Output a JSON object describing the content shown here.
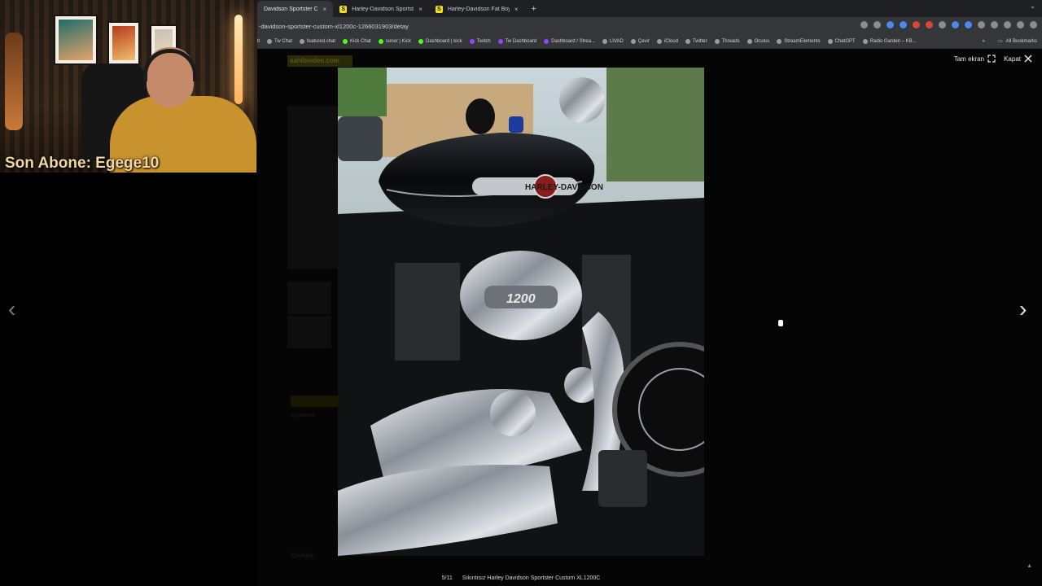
{
  "browser": {
    "tabs": [
      {
        "title": "Davidson Sportster C",
        "active": true,
        "has_favicon": false
      },
      {
        "title": "Harley-Davidson Sportster X",
        "active": false,
        "has_favicon": true
      },
      {
        "title": "Harley-Davidson Fat Boy FLS",
        "active": false,
        "has_favicon": true
      }
    ],
    "favicon_letter": "S",
    "tab_close": "×",
    "new_tab": "+",
    "url": "-davidson-sportster-custom-xl1200c-1266031903/detay",
    "bookmarks": [
      "lt",
      "Tw Chat",
      "featured.chat",
      "Kick Chat",
      "soner | Kick",
      "Dashboard | kick",
      "Twitch",
      "Tw Dashboard",
      "Dashboard / Strea...",
      "LIVAD",
      "Çevir",
      "iCloud",
      "Twitter",
      "Threads",
      "Oculus",
      "StreamElements",
      "ChatGPT",
      "Radio Garden – KB..."
    ],
    "bookmarks_overflow": "»",
    "all_bookmarks": "All Bookmarks"
  },
  "webcam": {
    "overlay_text": "Son Abone: Egege10"
  },
  "background_page": {
    "logo": "sahibinden.com",
    "description_label": "Açıklama",
    "details_label": "Özellikler"
  },
  "lightbox": {
    "fullscreen_label": "Tam ekran",
    "close_label": "Kapat",
    "prev_arrow": "‹",
    "next_arrow": "›",
    "counter": "5/11",
    "caption": "Sıkıntısız Harley Davidson Sportster Custom XL1200C",
    "photo_subject": "black chrome Harley-Davidson motorcycle engine",
    "tank_badge": "HARLEY-DAVIDSON",
    "engine_badge": "1200"
  }
}
